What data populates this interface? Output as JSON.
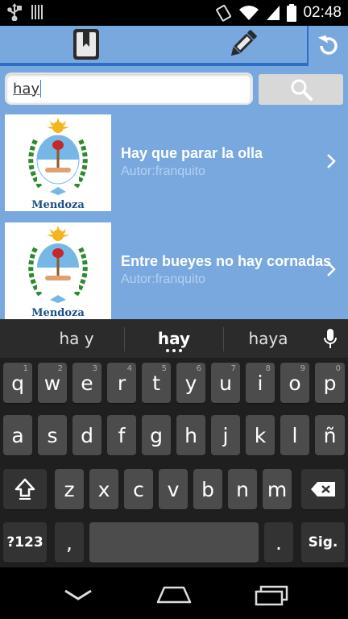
{
  "status_bar": {
    "time": "02:48",
    "icons": [
      "usb-icon",
      "sd-card-icon",
      "rotate-icon",
      "wifi-icon",
      "signal-icon",
      "battery-icon"
    ]
  },
  "app_bar": {
    "tabs": [
      {
        "icon": "bookmark-book-icon"
      },
      {
        "icon": "pencil-icon"
      }
    ],
    "refresh_icon": "refresh-icon"
  },
  "search": {
    "value": "hay",
    "button_icon": "search-icon"
  },
  "list": {
    "items": [
      {
        "title": "Hay que parar la olla",
        "author": "Autor:franquito",
        "image_caption": "Mendoza"
      },
      {
        "title": "Entre bueyes no hay cornadas",
        "author": "Autor:franquito",
        "image_caption": "Mendoza"
      }
    ]
  },
  "keyboard": {
    "suggestions": [
      "ha y",
      "hay",
      "haya"
    ],
    "rows": {
      "row1": [
        {
          "label": "q",
          "hint": "1"
        },
        {
          "label": "w",
          "hint": "2"
        },
        {
          "label": "e",
          "hint": "3"
        },
        {
          "label": "r",
          "hint": "4"
        },
        {
          "label": "t",
          "hint": "5"
        },
        {
          "label": "y",
          "hint": "6"
        },
        {
          "label": "u",
          "hint": "7"
        },
        {
          "label": "i",
          "hint": "8"
        },
        {
          "label": "o",
          "hint": "9"
        },
        {
          "label": "p",
          "hint": "0"
        }
      ],
      "row2": [
        "a",
        "s",
        "d",
        "f",
        "g",
        "h",
        "j",
        "k",
        "l",
        "ñ"
      ],
      "row3": [
        "z",
        "x",
        "c",
        "v",
        "b",
        "n",
        "m"
      ],
      "row4": {
        "symbols": "?123",
        "comma": ",",
        "period": ".",
        "enter": "Sig."
      }
    }
  },
  "colors": {
    "app_blue": "#78a8de",
    "accent_blue": "#2c6fc4",
    "keyboard_bg": "#1f1f1f"
  }
}
